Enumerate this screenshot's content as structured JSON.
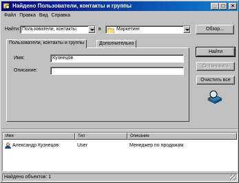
{
  "window": {
    "title": "Найдено Пользователи, контакты и группы",
    "min": "_",
    "max": "□",
    "close": "×"
  },
  "menu": [
    "Файл",
    "Правка",
    "Вид",
    "Справка"
  ],
  "find": {
    "label": "Найти:",
    "value": "Пользователи, контакты",
    "in_label": "в",
    "location": "Маркетинг",
    "browse_label": "Обзор..."
  },
  "tabs": [
    "Пользователи, контакты и группы",
    "Дополнительно"
  ],
  "form": {
    "name_label": "Имя:",
    "name_value": "Кузнецов",
    "desc_label": "Описание:",
    "desc_value": ""
  },
  "buttons": {
    "find_now": "Найти",
    "stop": "Остановить",
    "clear_all": "Очистить все"
  },
  "results": {
    "columns": [
      "Имя",
      "Тип",
      "Описание"
    ],
    "rows": [
      {
        "name": "Александр Кузнецов",
        "type": "User",
        "description": "Менеджер по продажам"
      }
    ]
  },
  "status": "Найдено объектов: 1",
  "colors": {
    "title_start": "#000080",
    "title_end": "#1084d0",
    "face": "#c0c0c0"
  },
  "icons": [
    "search-window-icon",
    "folder-icon",
    "search-magnifier-icon",
    "user-icon"
  ]
}
